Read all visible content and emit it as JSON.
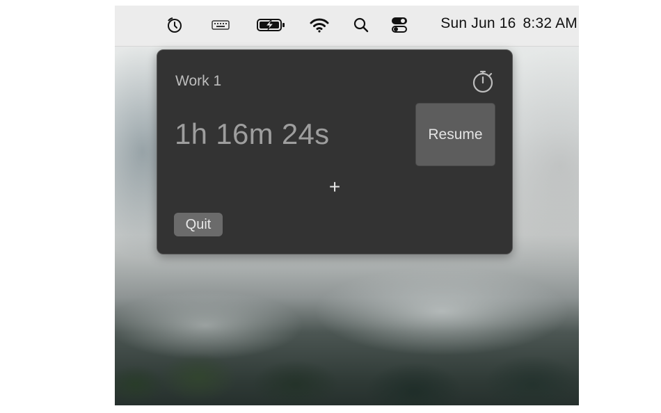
{
  "menubar": {
    "icons": [
      {
        "name": "timer-app-icon"
      },
      {
        "name": "keyboard-icon"
      },
      {
        "name": "battery-charging-icon"
      },
      {
        "name": "wifi-icon"
      },
      {
        "name": "search-icon"
      },
      {
        "name": "control-center-icon"
      }
    ],
    "day_date": "Sun Jun 16",
    "time": "8:32 AM"
  },
  "popover": {
    "timer_name": "Work 1",
    "elapsed": "1h 16m 24s",
    "resume_label": "Resume",
    "add_label": "+",
    "quit_label": "Quit",
    "stopwatch_icon": "stopwatch-icon"
  },
  "colors": {
    "popover_bg": "#333333",
    "resume_bg": "#5d5d5d",
    "quit_bg": "#6b6b6b",
    "menubar_bg": "#ececec"
  }
}
